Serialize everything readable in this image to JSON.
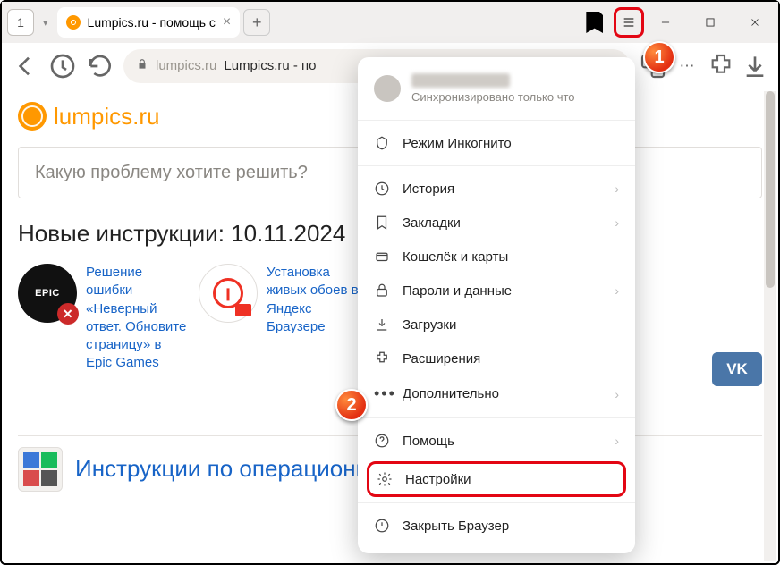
{
  "tabbar": {
    "pinned_count": "1",
    "tab_title": "Lumpics.ru - помощь с",
    "newtab": "+"
  },
  "address": {
    "domain": "lumpics.ru",
    "page_title": "Lumpics.ru - по"
  },
  "brand": "lumpics.ru",
  "search_placeholder": "Какую проблему хотите решить?",
  "section_heading": "Новые инструкции: 10.11.2024",
  "articles": [
    {
      "thumb_label": "EPIC",
      "title": "Решение ошибки «Неверный ответ. Обновите страницу» в Epic Games"
    },
    {
      "thumb_label": "",
      "title": "Установка живых обоев в Яндекс Браузере"
    }
  ],
  "os_heading": "Инструкции по операционн",
  "vk_label": "VK",
  "menu": {
    "profile_sub": "Синхронизировано только что",
    "items": [
      {
        "label": "Режим Инкогнито",
        "chev": false
      },
      {
        "label": "История",
        "chev": true
      },
      {
        "label": "Закладки",
        "chev": true
      },
      {
        "label": "Кошелёк и карты",
        "chev": false
      },
      {
        "label": "Пароли и данные",
        "chev": true
      },
      {
        "label": "Загрузки",
        "chev": false
      },
      {
        "label": "Расширения",
        "chev": false
      },
      {
        "label": "Дополнительно",
        "chev": true
      },
      {
        "label": "Помощь",
        "chev": true
      },
      {
        "label": "Настройки",
        "chev": false
      },
      {
        "label": "Закрыть Браузер",
        "chev": false
      }
    ]
  },
  "steps": {
    "one": "1",
    "two": "2"
  }
}
